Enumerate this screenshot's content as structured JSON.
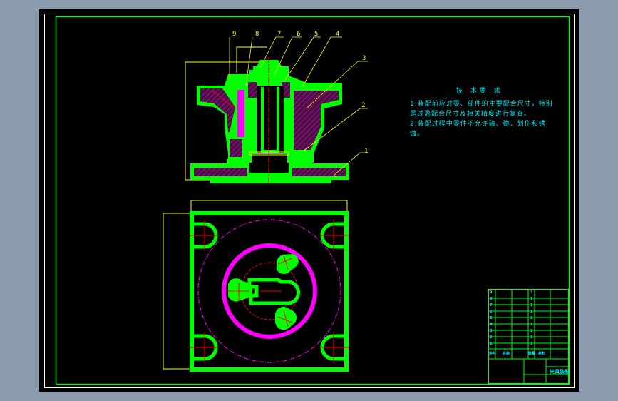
{
  "drawing": {
    "colors": {
      "background": "#000000",
      "frame": "#00ff00",
      "part": "#00ff00",
      "hatch": "#ff00ff",
      "centerline": "#ff0000",
      "dimension": "#ffff00",
      "text": "#00e5ee"
    },
    "balloons": [
      "1",
      "2",
      "3",
      "4",
      "5",
      "6",
      "7",
      "8",
      "9"
    ],
    "tech_requirements": {
      "title": "技 术要 求",
      "line1": "1:装配前应对零、部件的主要配合尺寸，特别",
      "line2": "是过盈配合尺寸及相关精度进行复查。",
      "line3": "2:装配过程中零件不允许磕、碰、划伤和锈",
      "line4": "蚀。"
    },
    "title_block": {
      "rows": [
        {
          "no": "9",
          "qty": "1"
        },
        {
          "no": "8",
          "qty": "1"
        },
        {
          "no": "7",
          "qty": "1"
        },
        {
          "no": "6",
          "qty": "1"
        },
        {
          "no": "5",
          "qty": "1"
        },
        {
          "no": "4",
          "qty": "1"
        },
        {
          "no": "3",
          "qty": "1"
        },
        {
          "no": "2",
          "qty": "1"
        },
        {
          "no": "1",
          "qty": "1"
        }
      ],
      "header": {
        "no": "序号",
        "name": "名称",
        "qty": "数量",
        "material": "材料"
      },
      "drawing_name": "夹具装配"
    }
  }
}
